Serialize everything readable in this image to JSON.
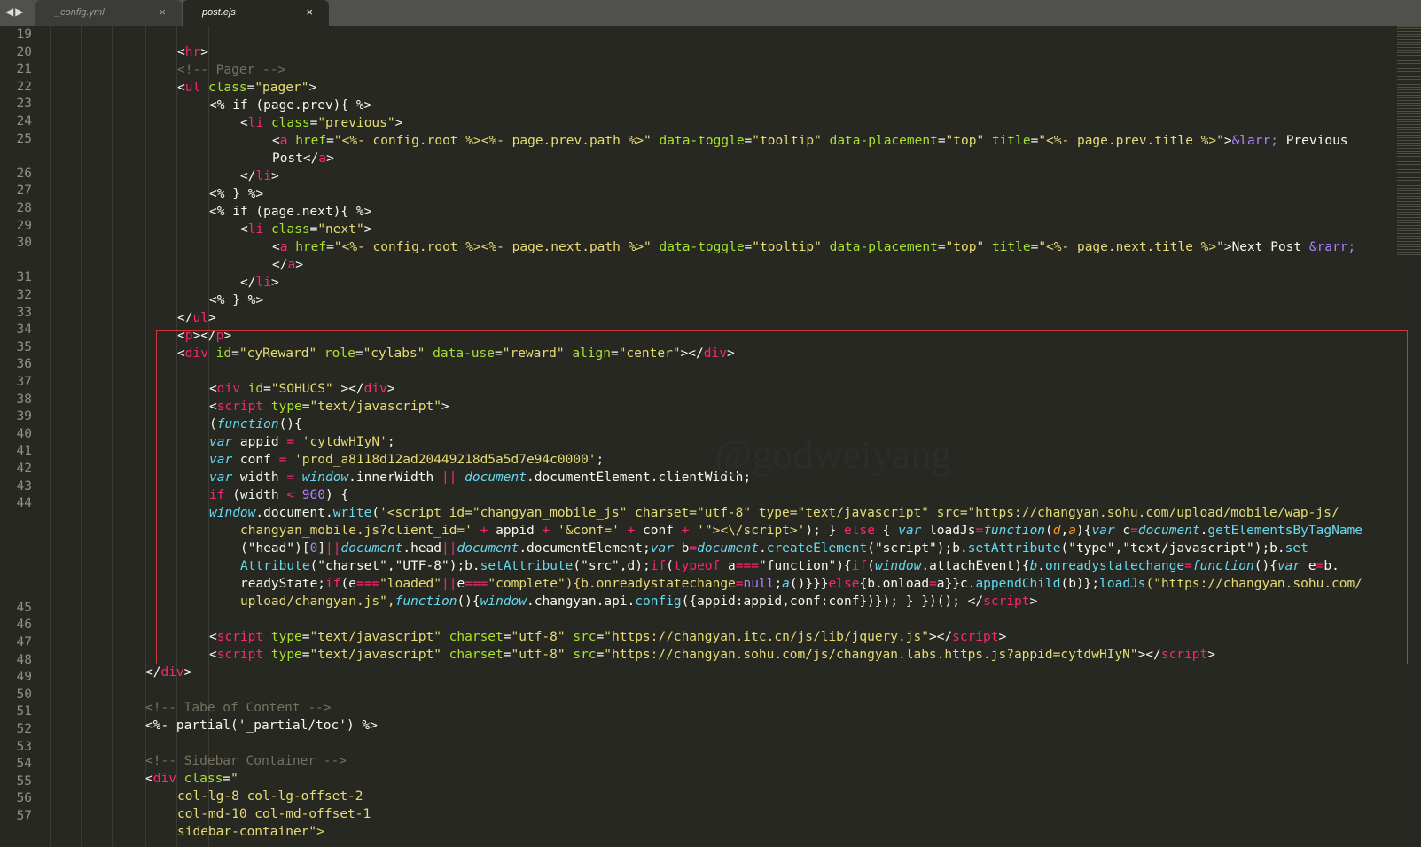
{
  "tabs": [
    {
      "label": "_config.yml",
      "close": "×",
      "active": false
    },
    {
      "label": "post.ejs",
      "close": "×",
      "active": true
    }
  ],
  "nav": {
    "arrows": "◀▶"
  },
  "line_numbers": [
    "19",
    "20",
    "21",
    "22",
    "23",
    "24",
    "25",
    "26",
    "27",
    "28",
    "29",
    "30",
    "31",
    "32",
    "33",
    "34",
    "35",
    "36",
    "37",
    "38",
    "39",
    "40",
    "41",
    "42",
    "43",
    "44",
    "45",
    "46",
    "47",
    "48",
    "49",
    "50",
    "51",
    "52",
    "53",
    "54",
    "55",
    "56",
    "57"
  ],
  "watermark": "@godweiyang",
  "colors": {
    "tag": "#f92672",
    "attr": "#a6e22e",
    "string": "#e6db74",
    "comment": "#75715e",
    "builtin": "#66d9ef",
    "number": "#ae81ff",
    "text": "#f8f8f2",
    "background": "#272822",
    "selection_box": "#d0343f"
  },
  "code": {
    "l20": [
      "<",
      "hr",
      ">"
    ],
    "l21": "<!-- Pager -->",
    "l22": [
      "<",
      "ul",
      " ",
      "class",
      "=",
      "\"pager\"",
      ">"
    ],
    "l23": "<% if (page.prev){ %>",
    "l24": [
      "<",
      "li",
      " ",
      "class",
      "=",
      "\"previous\"",
      ">"
    ],
    "l25": [
      "<",
      "a",
      " ",
      "href",
      "=",
      "\"<%- config.root %><%- page.prev.path %>\"",
      " ",
      "data-toggle",
      "=",
      "\"tooltip\"",
      " ",
      "data-placement",
      "=",
      "\"top\"",
      " ",
      "title",
      "=",
      "\"<%- page.prev.title %>\"",
      ">",
      "&larr;",
      " Previous"
    ],
    "l25b": [
      "Post</",
      "a",
      ">"
    ],
    "l26": [
      "</",
      "li",
      ">"
    ],
    "l27": "<% } %>",
    "l28": "<% if (page.next){ %>",
    "l29": [
      "<",
      "li",
      " ",
      "class",
      "=",
      "\"next\"",
      ">"
    ],
    "l30": [
      "<",
      "a",
      " ",
      "href",
      "=",
      "\"<%- config.root %><%- page.next.path %>\"",
      " ",
      "data-toggle",
      "=",
      "\"tooltip\"",
      " ",
      "data-placement",
      "=",
      "\"top\"",
      " ",
      "title",
      "=",
      "\"<%- page.next.title %>\"",
      ">Next Post ",
      "&rarr;"
    ],
    "l30b": [
      "</",
      "a",
      ">"
    ],
    "l31": [
      "</",
      "li",
      ">"
    ],
    "l32": "<% } %>",
    "l33": [
      "</",
      "ul",
      ">"
    ],
    "l34": [
      "<",
      "p",
      "></",
      "p",
      ">"
    ],
    "l35": [
      "<",
      "div",
      " ",
      "id",
      "=",
      "\"cyReward\"",
      " ",
      "role",
      "=",
      "\"cylabs\"",
      " ",
      "data-use",
      "=",
      "\"reward\"",
      " ",
      "align",
      "=",
      "\"center\"",
      "></",
      "div",
      ">"
    ],
    "l37": [
      "<",
      "div",
      " ",
      "id",
      "=",
      "\"SOHUCS\"",
      " ></",
      "div",
      ">"
    ],
    "l38": [
      "<",
      "script",
      " ",
      "type",
      "=",
      "\"text/javascript\"",
      ">"
    ],
    "l39": [
      "(",
      "function",
      "(){"
    ],
    "l40": [
      "var",
      " appid ",
      "=",
      " ",
      "'cytdwHIyN'",
      ";"
    ],
    "l41": [
      "var",
      " conf ",
      "=",
      " ",
      "'prod_a8118d12ad20449218d5a5d7e94c0000'",
      ";"
    ],
    "l42": [
      "var",
      " width ",
      "=",
      " ",
      "window",
      ".innerWidth ",
      "||",
      " ",
      "document",
      ".documentElement.clientWidth;"
    ],
    "l43": [
      "if",
      " (width ",
      "<",
      " ",
      "960",
      ") {"
    ],
    "l44": [
      "window",
      ".document.",
      "write",
      "(",
      "'<script id=\"changyan_mobile_js\" charset=\"utf-8\" type=\"text/javascript\" src=\"https://changyan.sohu.com/upload/mobile/wap-js/"
    ],
    "l44b": [
      "changyan_mobile.js?client_id='",
      " + ",
      "appid",
      " + ",
      "'&conf='",
      " + ",
      "conf",
      " + ",
      "'\"><\\/script>'",
      "); } ",
      "else",
      " { ",
      "var",
      " loadJs",
      "=",
      "function",
      "(",
      "d",
      ",",
      "a",
      "){",
      "var",
      " c",
      "=",
      "document",
      ".",
      "getElementsByTagName"
    ],
    "l44c": [
      "(\"head\")[",
      "0",
      "]",
      "||",
      "document",
      ".head",
      "||",
      "document",
      ".documentElement;",
      "var",
      " b",
      "=",
      "document",
      ".",
      "createElement",
      "(\"script\");b.",
      "setAttribute",
      "(\"type\",\"text/javascript\");b.",
      "set"
    ],
    "l44d": [
      "Attribute",
      "(\"charset\",\"UTF-8\");b.",
      "setAttribute",
      "(\"src\",d);",
      "if",
      "(",
      "typeof",
      " a",
      "===",
      "\"function\"){",
      "if",
      "(",
      "window",
      ".attachEvent){",
      "b",
      ".",
      "onreadystatechange",
      "=",
      "function",
      "(){",
      "var",
      " e",
      "=",
      "b."
    ],
    "l44e": [
      "readyState;",
      "if",
      "(e",
      "===",
      "\"loaded\"",
      "||",
      "e",
      "===",
      "\"complete\"){b.onreadystatechange",
      "=",
      "null",
      ";",
      "a",
      "()}}}",
      "else",
      "{b.onload",
      "=",
      "a}}c.",
      "appendChild",
      "(b)};",
      "loadJs",
      "(\"https://changyan.sohu.com/"
    ],
    "l44f": [
      "upload/changyan.js\",",
      "function",
      "(){",
      "window",
      ".changyan.api.",
      "config",
      "({appid:appid,conf:conf})}); } })(); </",
      "script",
      ">"
    ],
    "l46": [
      "<",
      "script",
      " ",
      "type",
      "=",
      "\"text/javascript\"",
      " ",
      "charset",
      "=",
      "\"utf-8\"",
      " ",
      "src",
      "=",
      "\"https://changyan.itc.cn/js/lib/jquery.js\"",
      "></",
      "script",
      ">"
    ],
    "l47": [
      "<",
      "script",
      " ",
      "type",
      "=",
      "\"text/javascript\"",
      " ",
      "charset",
      "=",
      "\"utf-8\"",
      " ",
      "src",
      "=",
      "\"https://changyan.sohu.com/js/changyan.labs.https.js?appid=cytdwHIyN\"",
      "></",
      "script",
      ">"
    ],
    "l48": [
      "</",
      "div",
      ">"
    ],
    "l50": "<!-- Tabe of Content -->",
    "l51": "<%- partial('_partial/toc') %>",
    "l53": "<!-- Sidebar Container -->",
    "l54": [
      "<",
      "div",
      " ",
      "class",
      "=",
      "\""
    ],
    "l55": "col-lg-8 col-lg-offset-2",
    "l56": "col-md-10 col-md-offset-1",
    "l57": "sidebar-container\">"
  }
}
